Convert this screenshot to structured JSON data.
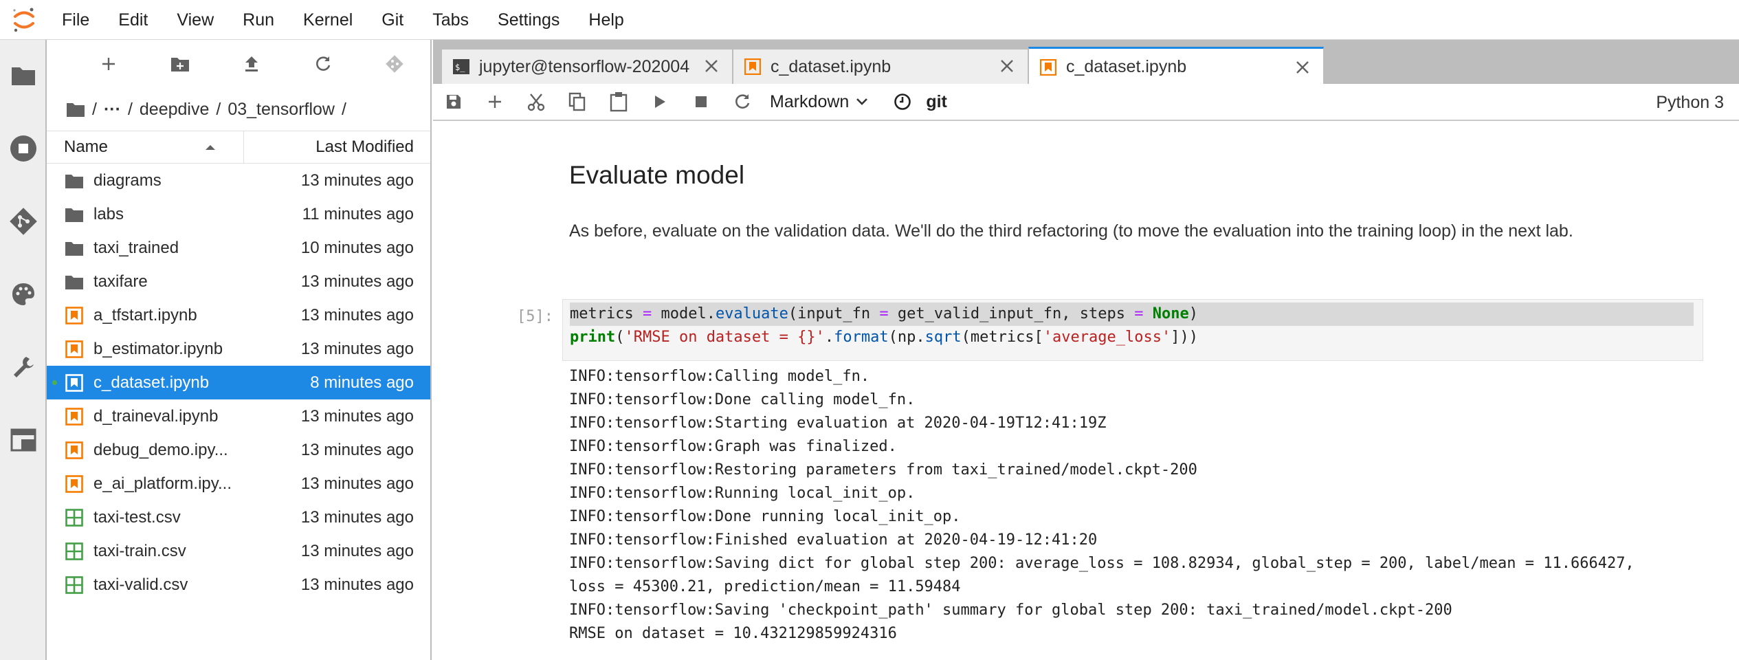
{
  "menu": [
    "File",
    "Edit",
    "View",
    "Run",
    "Kernel",
    "Git",
    "Tabs",
    "Settings",
    "Help"
  ],
  "activity_bar": [
    "folder-icon",
    "running-icon",
    "git-icon",
    "palette-icon",
    "wrench-icon",
    "tabs-icon"
  ],
  "file_browser": {
    "toolbar": [
      "new-launcher-icon",
      "new-folder-icon",
      "upload-icon",
      "refresh-icon",
      "git-clone-icon"
    ],
    "breadcrumbs": {
      "sep1": "/",
      "ellipsis": "···",
      "sep2": "/",
      "dir1": "deepdive",
      "sep3": "/",
      "dir2": "03_tensorflow",
      "sep4": "/"
    },
    "headers": {
      "name": "Name",
      "modified": "Last Modified"
    },
    "files": [
      {
        "name": "diagrams",
        "modified": "13 minutes ago",
        "type": "folder"
      },
      {
        "name": "labs",
        "modified": "11 minutes ago",
        "type": "folder"
      },
      {
        "name": "taxi_trained",
        "modified": "10 minutes ago",
        "type": "folder"
      },
      {
        "name": "taxifare",
        "modified": "13 minutes ago",
        "type": "folder"
      },
      {
        "name": "a_tfstart.ipynb",
        "modified": "13 minutes ago",
        "type": "notebook"
      },
      {
        "name": "b_estimator.ipynb",
        "modified": "13 minutes ago",
        "type": "notebook"
      },
      {
        "name": "c_dataset.ipynb",
        "modified": "8 minutes ago",
        "type": "notebook",
        "selected": true
      },
      {
        "name": "d_traineval.ipynb",
        "modified": "13 minutes ago",
        "type": "notebook"
      },
      {
        "name": "debug_demo.ipy...",
        "modified": "13 minutes ago",
        "type": "notebook"
      },
      {
        "name": "e_ai_platform.ipy...",
        "modified": "13 minutes ago",
        "type": "notebook"
      },
      {
        "name": "taxi-test.csv",
        "modified": "13 minutes ago",
        "type": "csv"
      },
      {
        "name": "taxi-train.csv",
        "modified": "13 minutes ago",
        "type": "csv"
      },
      {
        "name": "taxi-valid.csv",
        "modified": "13 minutes ago",
        "type": "csv"
      }
    ]
  },
  "tabs": [
    {
      "label": "jupyter@tensorflow-202004",
      "icon": "terminal-icon"
    },
    {
      "label": "c_dataset.ipynb",
      "icon": "notebook-icon"
    },
    {
      "label": "c_dataset.ipynb",
      "icon": "notebook-icon",
      "active": true
    }
  ],
  "notebook_toolbar": {
    "cell_type": "Markdown",
    "git_label": "git",
    "kernel": "Python 3"
  },
  "notebook": {
    "heading": "Evaluate model",
    "paragraph": "As before, evaluate on the validation data. We'll do the third refactoring (to move the evaluation into the training loop) in the next lab.",
    "cell_prompt": "[5]:",
    "code_line_1": [
      {
        "t": "metrics",
        "c": "var"
      },
      {
        "t": " ",
        "c": "var"
      },
      {
        "t": "=",
        "c": "op"
      },
      {
        "t": " model.",
        "c": "var"
      },
      {
        "t": "evaluate",
        "c": "fn"
      },
      {
        "t": "(input_fn ",
        "c": "var"
      },
      {
        "t": "=",
        "c": "op"
      },
      {
        "t": " get_valid_input_fn, steps ",
        "c": "var"
      },
      {
        "t": "=",
        "c": "op"
      },
      {
        "t": " ",
        "c": "var"
      },
      {
        "t": "None",
        "c": "kw"
      },
      {
        "t": ")",
        "c": "var"
      }
    ],
    "code_line_2": [
      {
        "t": "print",
        "c": "kw"
      },
      {
        "t": "(",
        "c": "var"
      },
      {
        "t": "'RMSE on dataset = {}'",
        "c": "str"
      },
      {
        "t": ".",
        "c": "var"
      },
      {
        "t": "format",
        "c": "fn"
      },
      {
        "t": "(np.",
        "c": "var"
      },
      {
        "t": "sqrt",
        "c": "fn"
      },
      {
        "t": "(metrics[",
        "c": "var"
      },
      {
        "t": "'average_loss'",
        "c": "str"
      },
      {
        "t": "]))",
        "c": "var"
      }
    ],
    "output": [
      "INFO:tensorflow:Calling model_fn.",
      "INFO:tensorflow:Done calling model_fn.",
      "INFO:tensorflow:Starting evaluation at 2020-04-19T12:41:19Z",
      "INFO:tensorflow:Graph was finalized.",
      "INFO:tensorflow:Restoring parameters from taxi_trained/model.ckpt-200",
      "INFO:tensorflow:Running local_init_op.",
      "INFO:tensorflow:Done running local_init_op.",
      "INFO:tensorflow:Finished evaluation at 2020-04-19-12:41:20",
      "INFO:tensorflow:Saving dict for global step 200: average_loss = 108.82934, global_step = 200, label/mean = 11.666427,",
      "loss = 45300.21, prediction/mean = 11.59484",
      "INFO:tensorflow:Saving 'checkpoint_path' summary for global step 200: taxi_trained/model.ckpt-200",
      "RMSE on dataset = 10.432129859924316"
    ]
  },
  "colors": {
    "accent": "#1e88e5",
    "notebook_icon": "#f57c00",
    "csv_icon": "#43a047",
    "folder_icon": "#616161"
  }
}
